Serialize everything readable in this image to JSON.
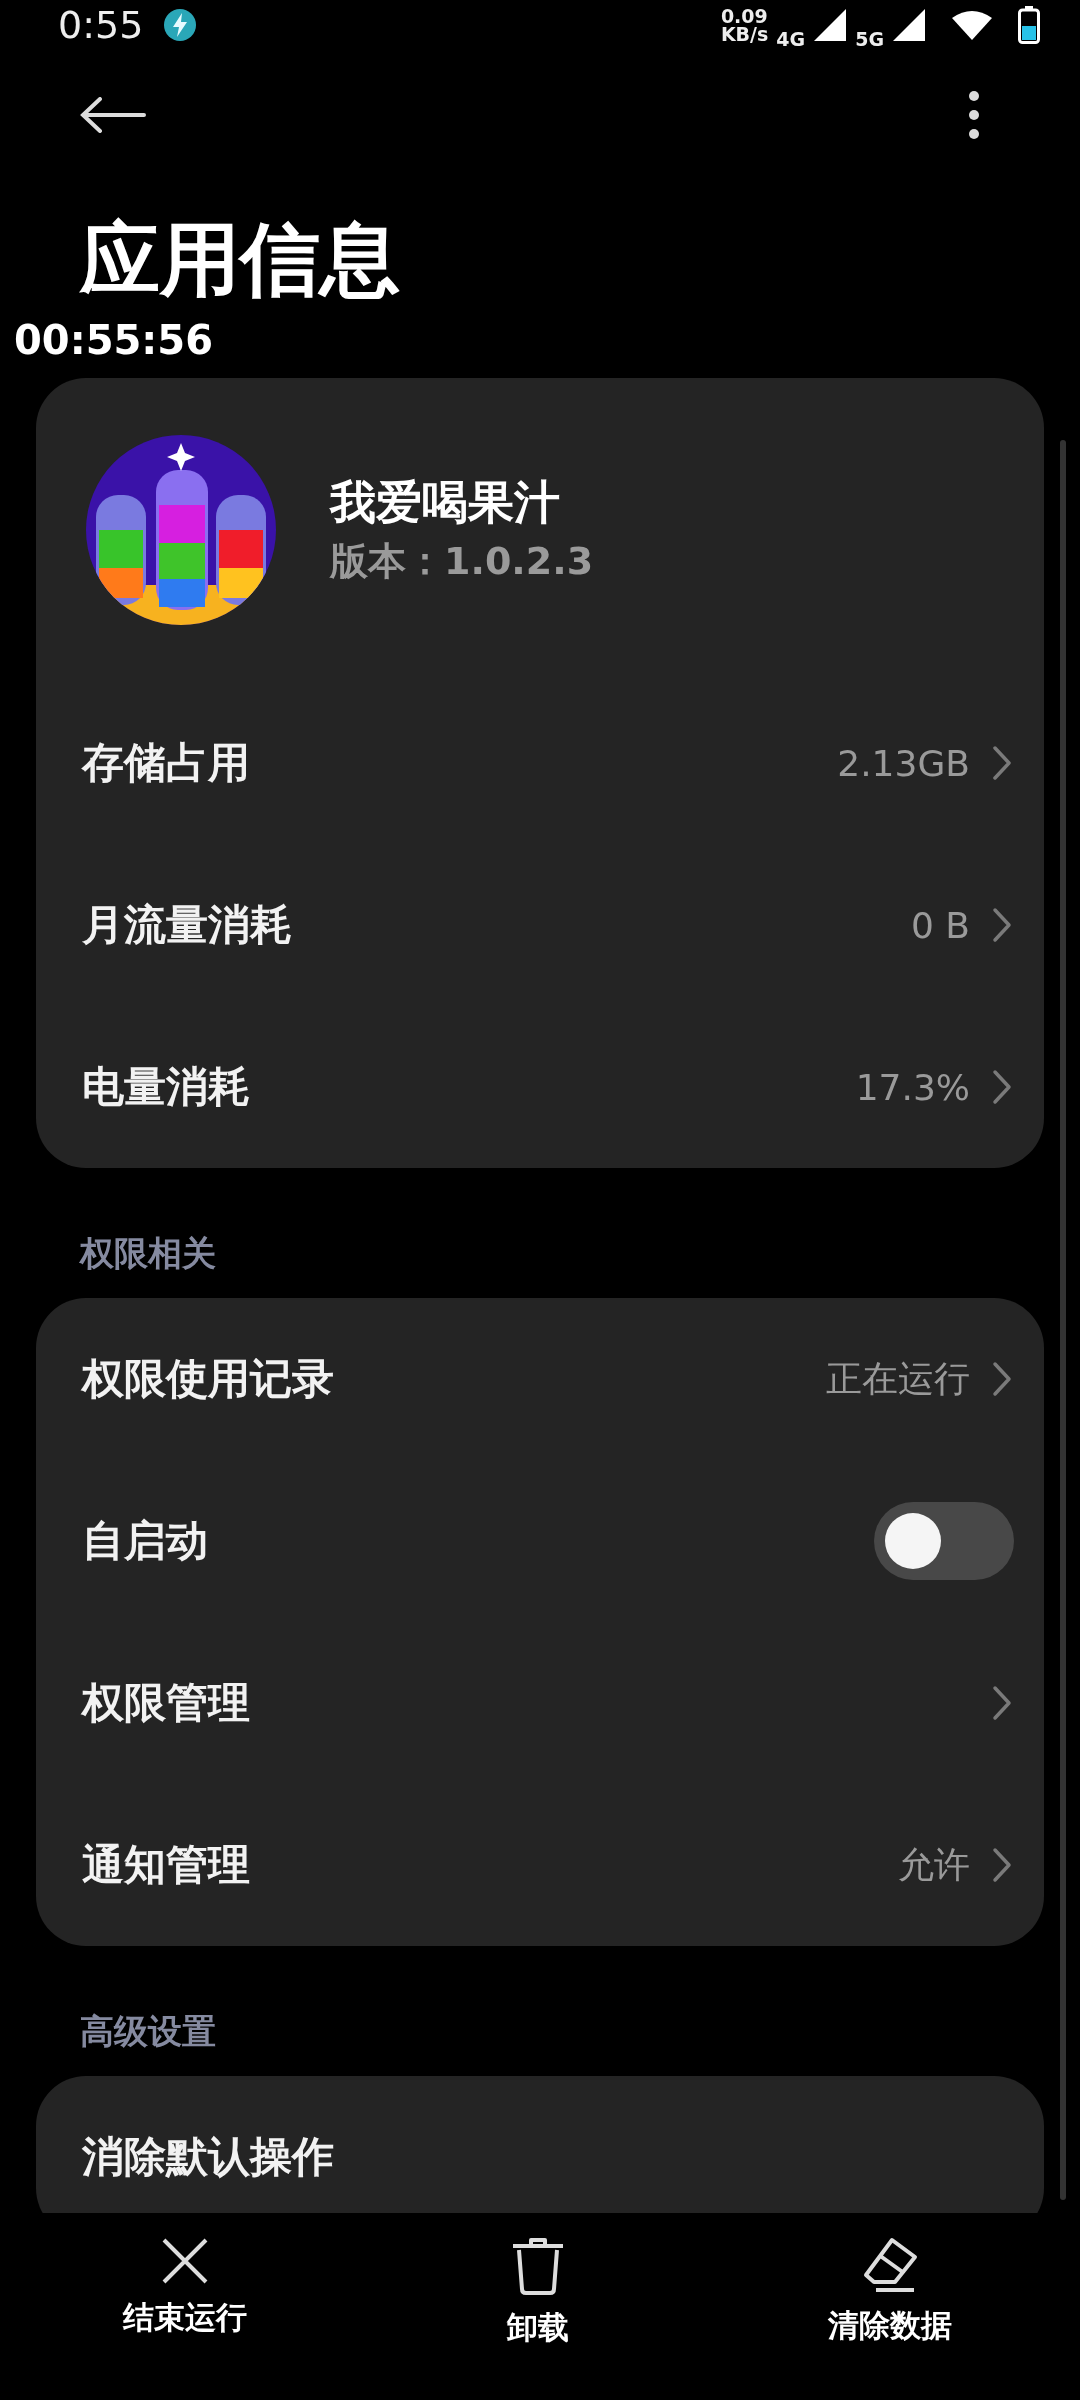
{
  "status_bar": {
    "time": "0:55",
    "net_speed": "0.09",
    "net_unit": "KB/s",
    "signals": [
      "4G",
      "5G"
    ]
  },
  "timestamp": "00:55:56",
  "title": "应用信息",
  "app": {
    "name": "我爱喝果汁",
    "version": "版本：1.0.2.3"
  },
  "cards": [
    {
      "rows": [
        {
          "kind": "link",
          "label": "存储占用",
          "value": "2.13GB"
        },
        {
          "kind": "link",
          "label": "月流量消耗",
          "value": "0 B"
        },
        {
          "kind": "link",
          "label": "电量消耗",
          "value": "17.3%"
        }
      ]
    },
    {
      "header": "权限相关",
      "rows": [
        {
          "kind": "link",
          "label": "权限使用记录",
          "value": "正在运行"
        },
        {
          "kind": "toggle",
          "label": "自启动",
          "on": false
        },
        {
          "kind": "link",
          "label": "权限管理"
        },
        {
          "kind": "link",
          "label": "通知管理",
          "value": "允许"
        }
      ]
    },
    {
      "header": "高级设置",
      "rows": [
        {
          "kind": "label",
          "label": "消除默认操作"
        }
      ]
    }
  ],
  "actions": [
    {
      "kind": "close",
      "label": "结束运行"
    },
    {
      "kind": "trash",
      "label": "卸载"
    },
    {
      "kind": "eraser",
      "label": "清除数据"
    }
  ]
}
